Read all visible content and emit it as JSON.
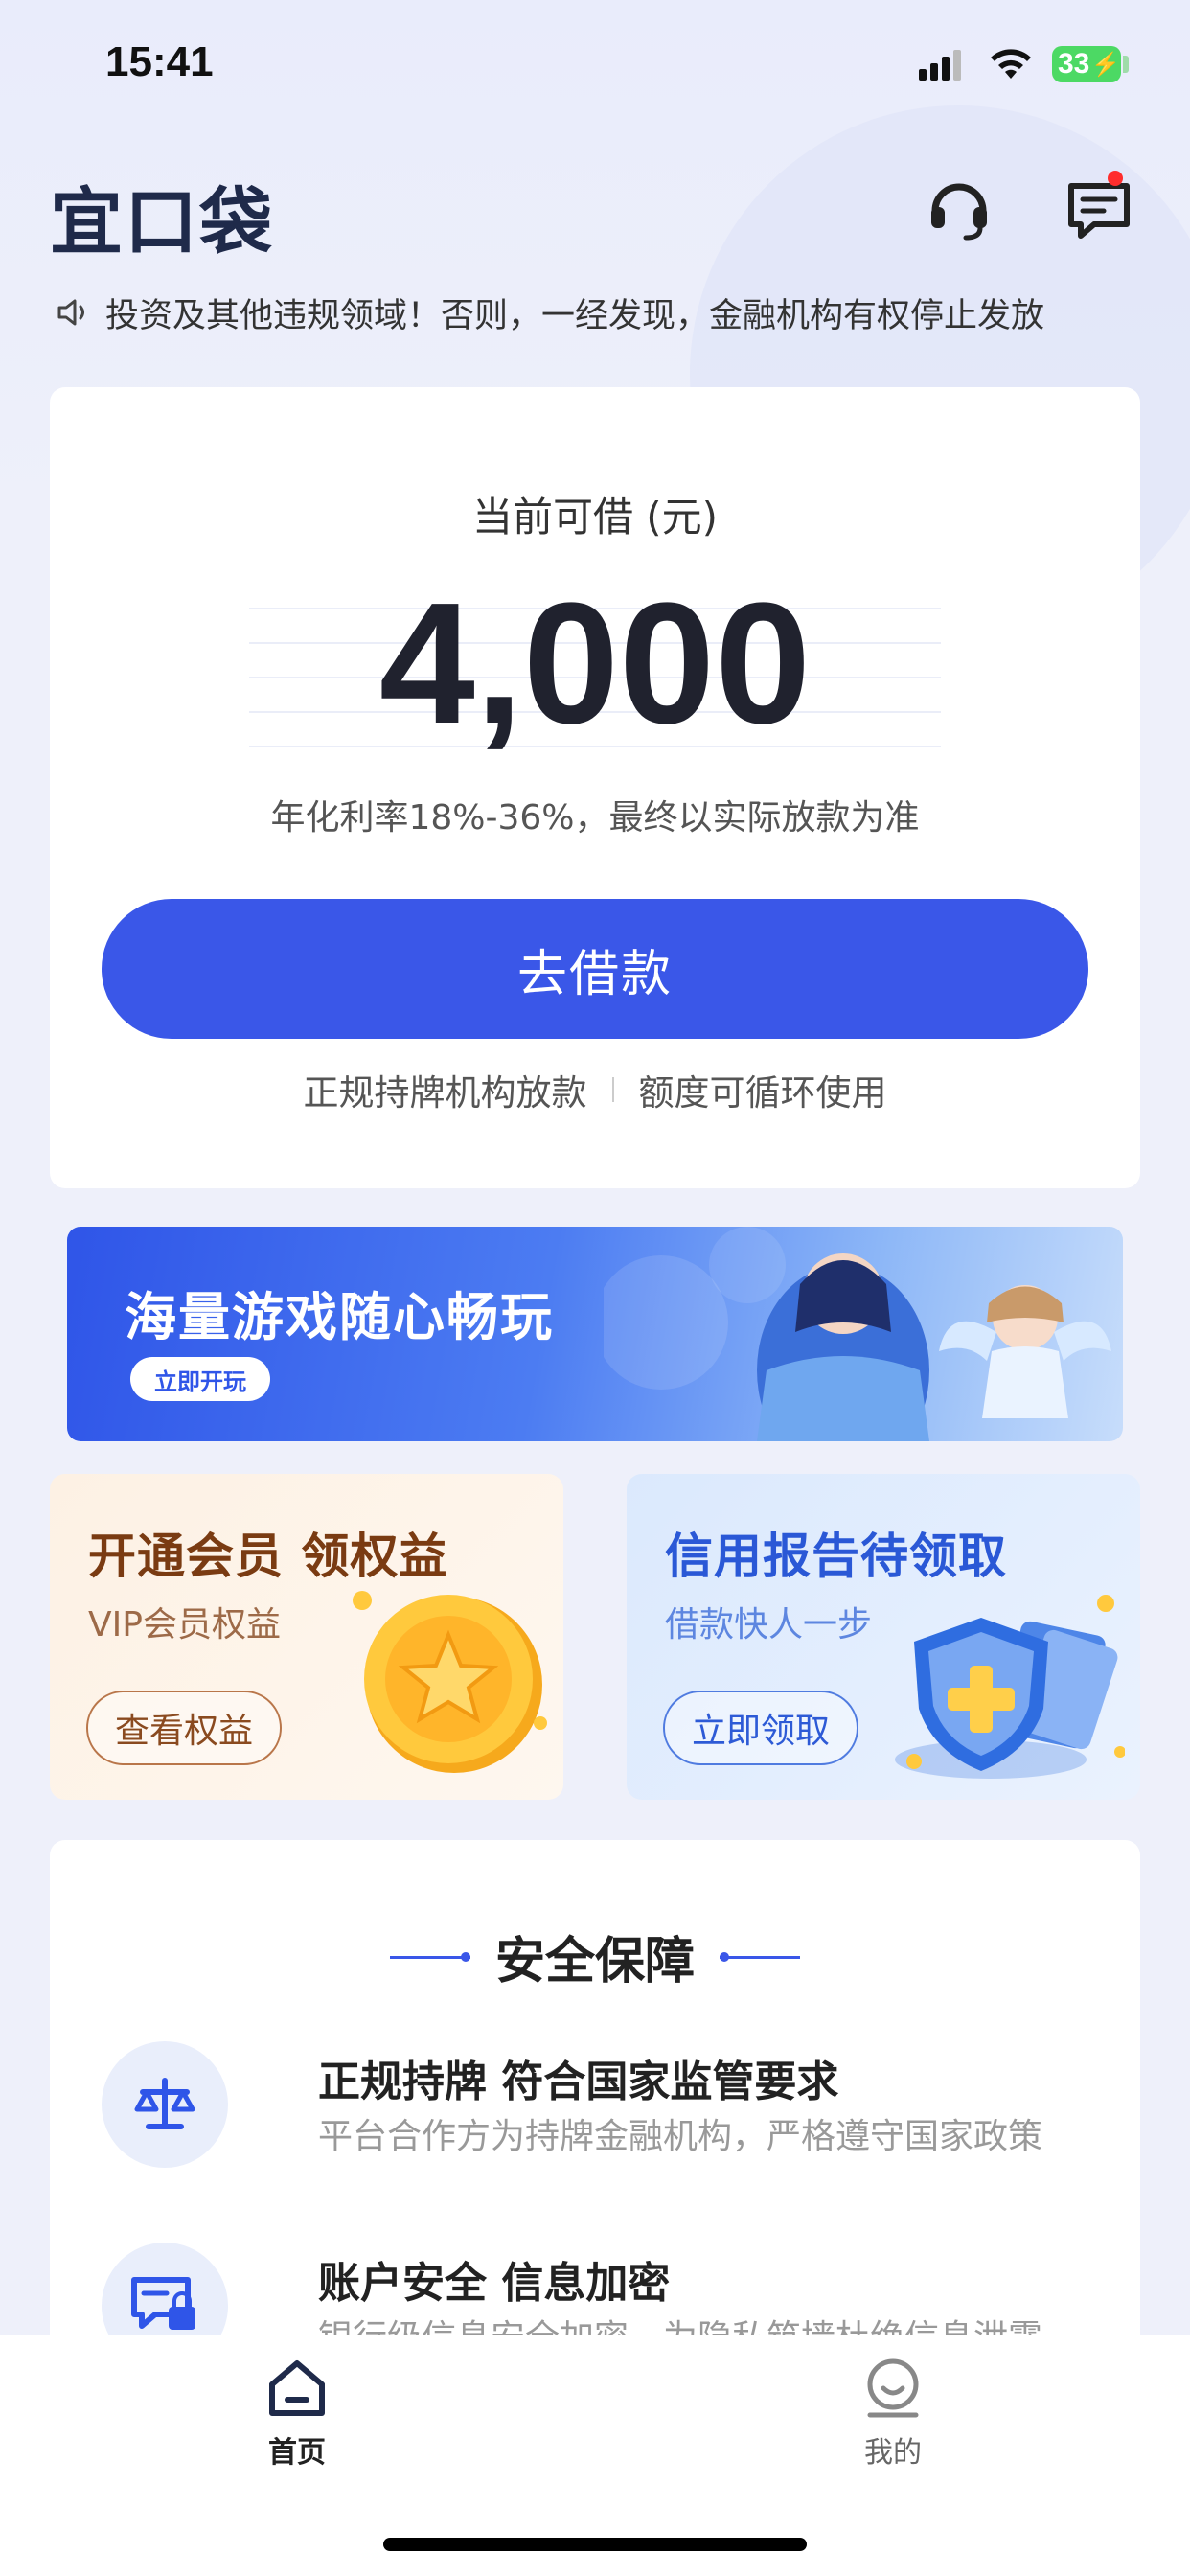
{
  "status_bar": {
    "time": "15:41",
    "battery": "33"
  },
  "header": {
    "logo": "宜口袋"
  },
  "notice": {
    "text": "投资及其他违规领域！否则，一经发现，金融机构有权停止发放"
  },
  "loan_card": {
    "label": "当前可借 (元)",
    "amount": "4,000",
    "rate_note": "年化利率18%-36%，最终以实际放款为准",
    "button": "去借款",
    "features": [
      "正规持牌机构放款",
      "额度可循环使用"
    ]
  },
  "banner": {
    "title": "海量游戏随心畅玩",
    "button": "立即开玩"
  },
  "promos": [
    {
      "title": "开通会员 领权益",
      "subtitle": "VIP会员权益",
      "button": "查看权益"
    },
    {
      "title": "信用报告待领取",
      "subtitle": "借款快人一步",
      "button": "立即领取"
    }
  ],
  "security": {
    "title": "安全保障",
    "items": [
      {
        "title": "正规持牌 符合国家监管要求",
        "desc": "平台合作方为持牌金融机构，严格遵守国家政策",
        "icon": "scale-icon"
      },
      {
        "title": "账户安全 信息加密",
        "desc": "银行级信息安全加密，为隐私筑墙杜绝信息泄露",
        "icon": "lock-message-icon"
      }
    ]
  },
  "tabbar": {
    "home": "首页",
    "mine": "我的"
  },
  "colors": {
    "primary": "#3a57e8",
    "background": "#eef0fa"
  }
}
